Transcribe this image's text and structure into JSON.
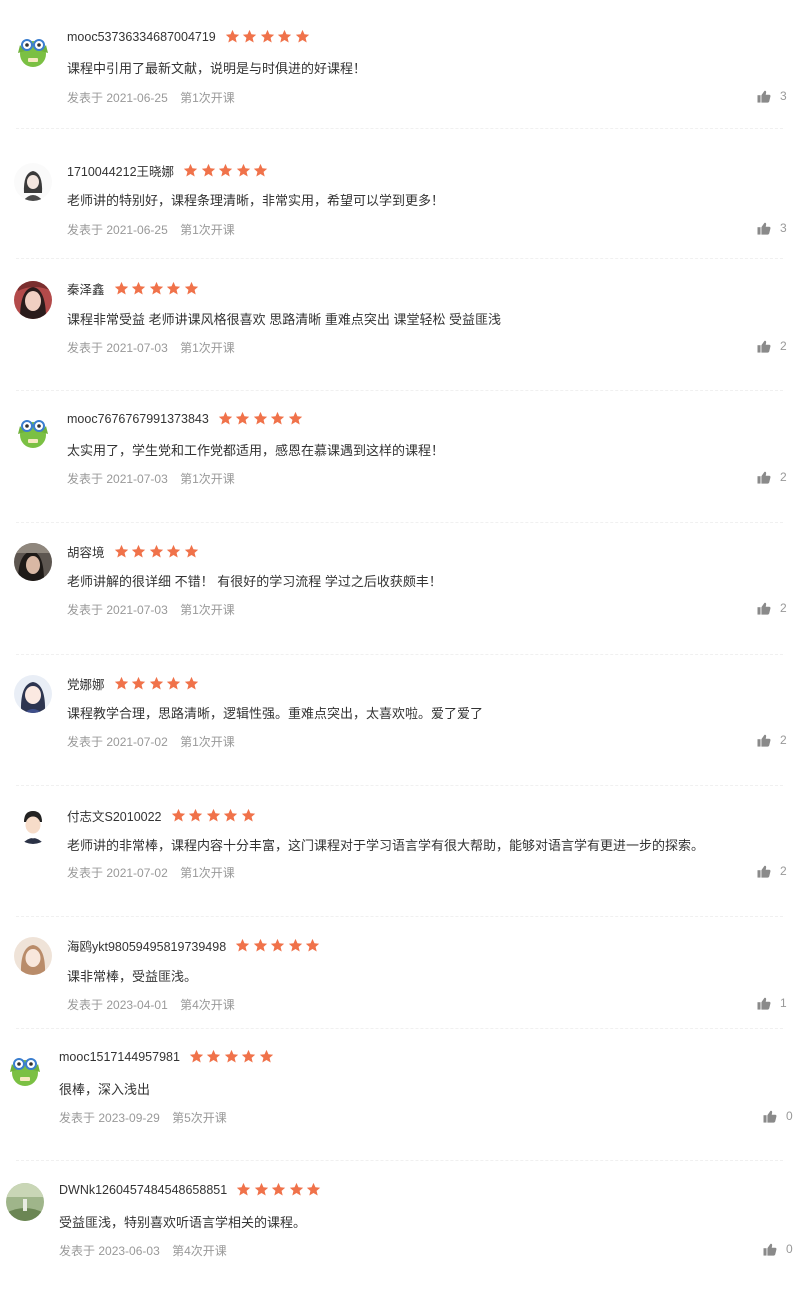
{
  "meta_prefix": "发表于",
  "reviews": [
    {
      "username": "mooc53736334687004719",
      "rating": 5,
      "content": "课程中引用了最新文献，说明是与时俱进的好课程！",
      "date": "2021-06-25",
      "term": "第1次开课",
      "likes": "3",
      "avatar": "green-mascot"
    },
    {
      "username": "1710044212王晓娜",
      "rating": 5,
      "content": "老师讲的特别好，课程条理清晰，非常实用，希望可以学到更多！",
      "date": "2021-06-25",
      "term": "第1次开课",
      "likes": "3",
      "avatar": "girl-sketch"
    },
    {
      "username": "秦泽鑫",
      "rating": 5,
      "content": "课程非常受益 老师讲课风格很喜欢 思路清晰 重难点突出 课堂轻松 受益匪浅",
      "date": "2021-07-03",
      "term": "第1次开课",
      "likes": "2",
      "avatar": "photo-girl-red"
    },
    {
      "username": "mooc7676767991373843",
      "rating": 5,
      "content": "太实用了，学生党和工作党都适用，感恩在慕课遇到这样的课程！",
      "date": "2021-07-03",
      "term": "第1次开课",
      "likes": "2",
      "avatar": "green-mascot"
    },
    {
      "username": "胡容境",
      "rating": 5,
      "content": "老师讲解的很详细 不错！ 有很好的学习流程 学过之后收获颇丰！",
      "date": "2021-07-03",
      "term": "第1次开课",
      "likes": "2",
      "avatar": "photo-dark"
    },
    {
      "username": "党娜娜",
      "rating": 5,
      "content": "课程教学合理，思路清晰，逻辑性强。重难点突出，太喜欢啦。爱了爱了",
      "date": "2021-07-02",
      "term": "第1次开课",
      "likes": "2",
      "avatar": "anime-girl"
    },
    {
      "username": "付志文S2010022",
      "rating": 5,
      "content": "老师讲的非常棒，课程内容十分丰富，这门课程对于学习语言学有很大帮助，能够对语言学有更进一步的探索。",
      "date": "2021-07-02",
      "term": "第1次开课",
      "likes": "2",
      "avatar": "cartoon-boy"
    },
    {
      "username": "海鸥ykt98059495819739498",
      "rating": 5,
      "content": "课非常棒，受益匪浅。",
      "date": "2023-04-01",
      "term": "第4次开课",
      "likes": "1",
      "avatar": "photo-beige"
    },
    {
      "username": "mooc1517144957981",
      "rating": 5,
      "content": "很棒，深入浅出",
      "date": "2023-09-29",
      "term": "第5次开课",
      "likes": "0",
      "avatar": "green-mascot"
    },
    {
      "username": "DWNk1260457484548658851",
      "rating": 5,
      "content": "受益匪浅，特别喜欢听语言学相关的课程。",
      "date": "2023-06-03",
      "term": "第4次开课",
      "likes": "0",
      "avatar": "photo-green"
    }
  ],
  "colors": {
    "star": "#f0724a",
    "text": "#333333",
    "meta": "#999999"
  },
  "icons": {
    "star": "star-icon",
    "like": "thumbs-up-icon"
  }
}
